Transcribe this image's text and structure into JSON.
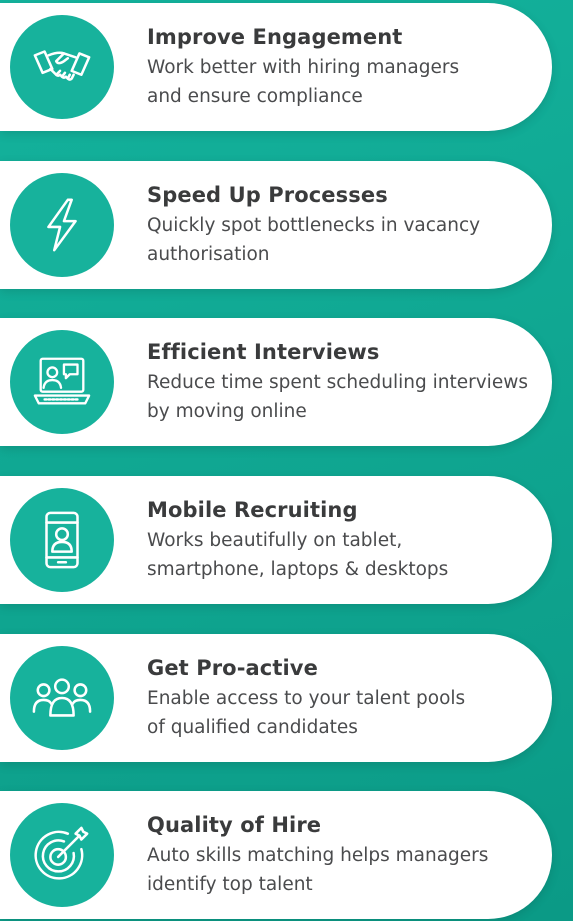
{
  "colors": {
    "background": "#12ad97",
    "accent": "#17b29c",
    "card": "#ffffff",
    "title": "#3a3b3c",
    "text": "#4a4b4d"
  },
  "features": [
    {
      "icon": "handshake-icon",
      "title": "Improve Engagement",
      "line1": "Work better with hiring managers",
      "line2": "and ensure compliance"
    },
    {
      "icon": "lightning-bolt-icon",
      "title": "Speed Up Processes",
      "line1": "Quickly spot bottlenecks in vacancy",
      "line2": "authorisation"
    },
    {
      "icon": "video-interview-laptop-icon",
      "title": "Efficient Interviews",
      "line1": "Reduce time spent scheduling interviews",
      "line2": "by moving online"
    },
    {
      "icon": "mobile-profile-icon",
      "title": "Mobile Recruiting",
      "line1": "Works beautifully on tablet,",
      "line2": "smartphone, laptops & desktops"
    },
    {
      "icon": "people-group-icon",
      "title": "Get Pro-active",
      "line1": "Enable access to your talent pools",
      "line2": "of qualified candidates"
    },
    {
      "icon": "target-dart-icon",
      "title": "Quality of Hire",
      "line1": "Auto skills matching helps managers",
      "line2": "identify top talent"
    }
  ]
}
